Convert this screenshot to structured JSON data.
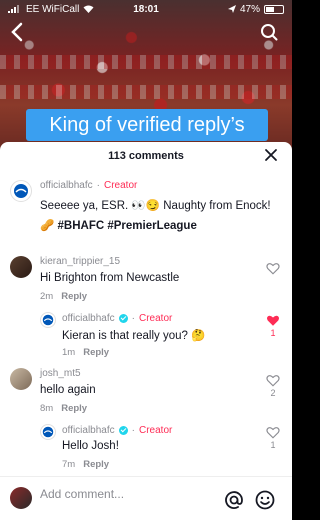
{
  "status": {
    "carrier": "EE WiFiCall",
    "time": "18:01",
    "battery": "47%",
    "battery_level": 0.47
  },
  "video": {
    "caption": "King of verified reply’s"
  },
  "sheet": {
    "count": "113 comments"
  },
  "comments": [
    {
      "user": "officialbhafc",
      "badge": "Creator",
      "line1": "Seeeee ya, ESR. 👀😏 Naughty from Enock!",
      "line2": "🥜 #BHAFC #PremierLeague"
    },
    {
      "user": "kieran_trippier_15",
      "text": "Hi Brighton from Newcastle",
      "time": "2m",
      "reply": "Reply"
    },
    {
      "user": "officialbhafc",
      "badge": "Creator",
      "text": "Kieran is that really you? 🤔",
      "time": "1m",
      "reply": "Reply",
      "likes": "1"
    },
    {
      "user": "josh_mt5",
      "text": "hello again",
      "time": "8m",
      "reply": "Reply",
      "likes": "2"
    },
    {
      "user": "officialbhafc",
      "badge": "Creator",
      "text": "Hello Josh!",
      "time": "7m",
      "reply": "Reply",
      "likes": "1"
    }
  ],
  "composer": {
    "placeholder": "Add comment..."
  },
  "icons": {
    "back": "chevron-left-icon",
    "search": "search-icon",
    "close": "close-icon",
    "like": "heart-icon",
    "mention": "at-icon",
    "emoji": "emoji-icon"
  },
  "colors": {
    "accent": "#fe2c55",
    "caption_bg": "#3a9ff0",
    "verified": "#20d5ec"
  }
}
